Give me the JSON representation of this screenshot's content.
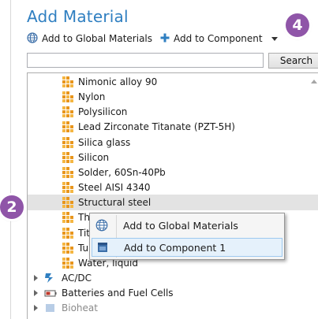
{
  "panel": {
    "title": "Add Material"
  },
  "callouts": {
    "step_top": "4",
    "step_left": "2"
  },
  "toolbar": {
    "add_global_label": "Add to Global Materials",
    "add_component_label": "Add to Component"
  },
  "search": {
    "value": "",
    "button_label": "Search"
  },
  "tree": {
    "materials": [
      "Nimonic alloy 90",
      "Nylon",
      "Polysilicon",
      "Lead Zirconate Titanate (PZT-5H)",
      "Silica glass",
      "Silicon",
      "Solder, 60Sn-40Pb",
      "Steel AISI 4340",
      "Structural steel",
      "Th",
      "Tit",
      "Tu",
      "Water, liquid"
    ],
    "selected": "Structural steel",
    "folders": [
      "AC/DC",
      "Batteries and Fuel Cells",
      "Bioheat"
    ]
  },
  "context_menu": {
    "items": [
      "Add to Global Materials",
      "Add to Component 1"
    ],
    "highlighted": "Add to Component 1"
  },
  "colors": {
    "title": "#2f7fc1",
    "callout": "#8f55a8",
    "material_icon": "#e8951c",
    "selection": "#e3e3e3",
    "menu_hover": "#e5f1fb"
  },
  "icons": {
    "material": "material-grid-icon",
    "global": "globe-icon",
    "component": "component-icon",
    "add": "plus-icon"
  }
}
